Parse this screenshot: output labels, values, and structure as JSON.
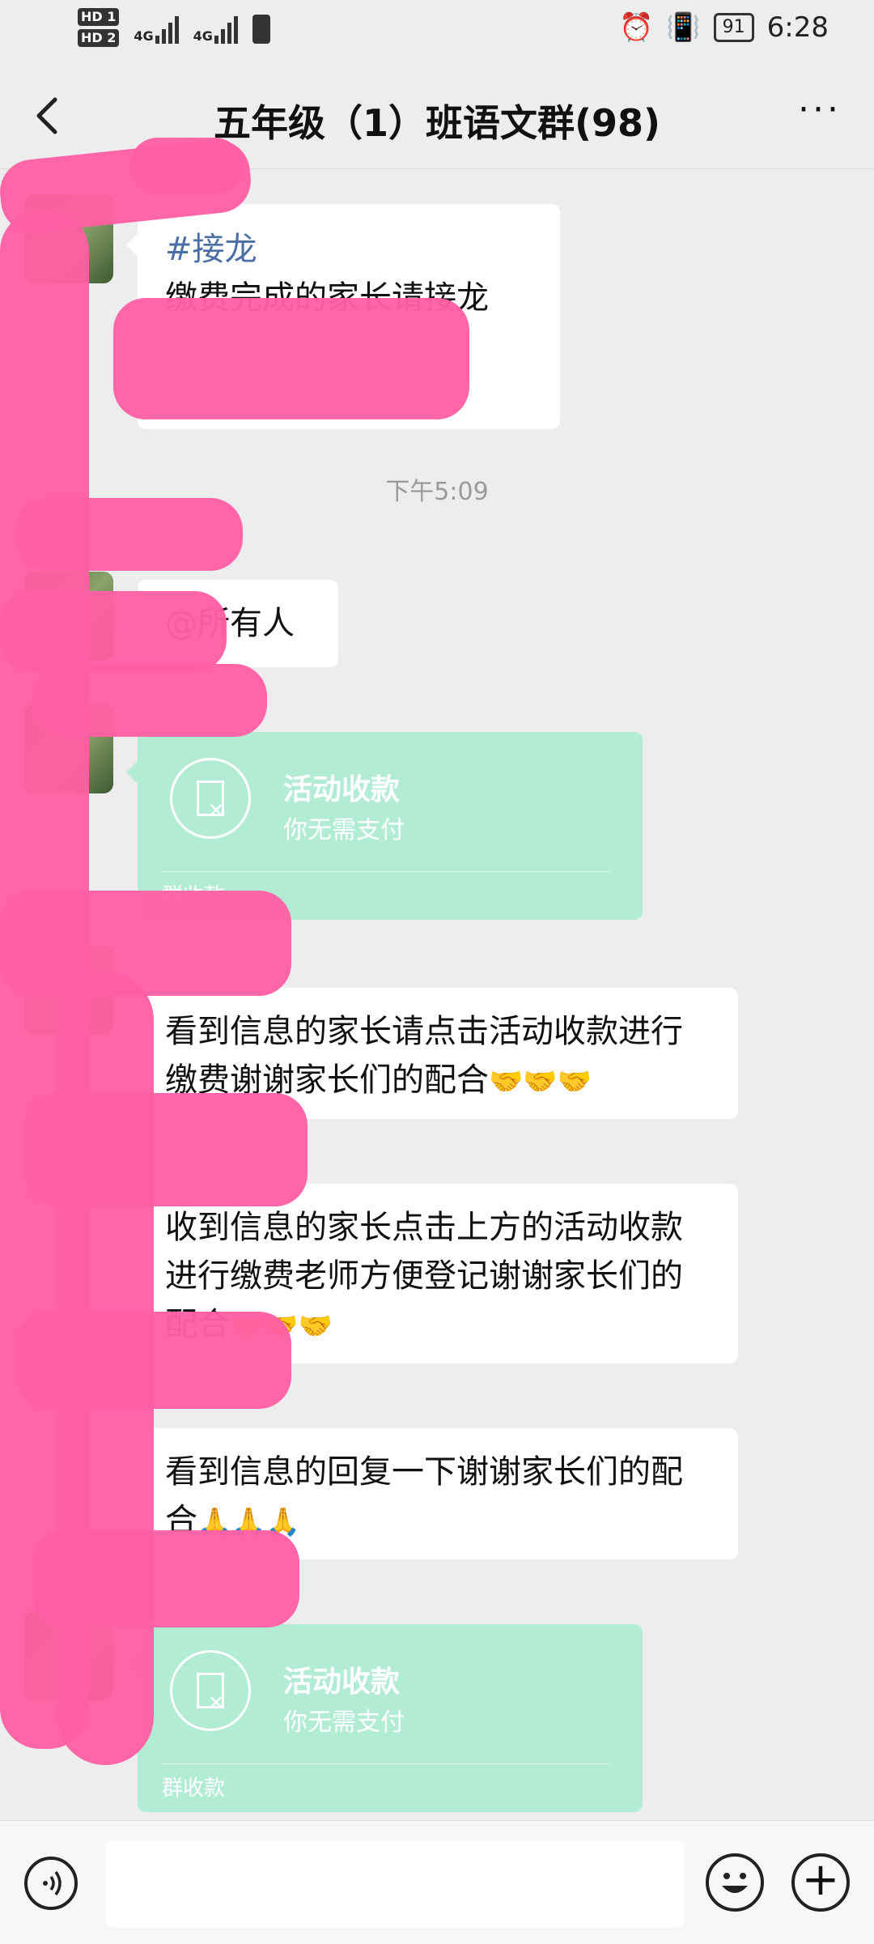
{
  "status_bar": {
    "time": "6:28",
    "battery": "91",
    "network_left": [
      "HD 1",
      "HD 2"
    ],
    "network_type": [
      "4G",
      "4G"
    ]
  },
  "header": {
    "title": "五年级（1）班语文群(98)",
    "more_label": "···"
  },
  "messages": {
    "m1_tag": "#接龙",
    "m1_text": "缴费完成的家长请接龙",
    "time1": "下午5:09",
    "m2_text": "@所有人",
    "pay1": {
      "title": "活动收款",
      "subtitle": "你无需支付",
      "footer": "群收款"
    },
    "m3_text": "看到信息的家长请点击活动收款进行缴费谢谢家长们的配合",
    "m3_emoji": "🤝🤝🤝",
    "m4_text": "收到信息的家长点击上方的活动收款进行缴费老师方便登记谢谢家长们的配合",
    "m4_emoji": "🤝🤝🤝",
    "m5_text": "看到信息的回复一下谢谢家长们的配合",
    "m5_emoji": "🙏🙏🙏",
    "pay2": {
      "title": "活动收款",
      "subtitle": "你无需支付",
      "footer": "群收款"
    }
  },
  "colors": {
    "bg": "#ededed",
    "bubble": "#ffffff",
    "pay_card": "#b3ecd4",
    "redaction": "#ff5fa3",
    "tag": "#4a6fa5"
  }
}
